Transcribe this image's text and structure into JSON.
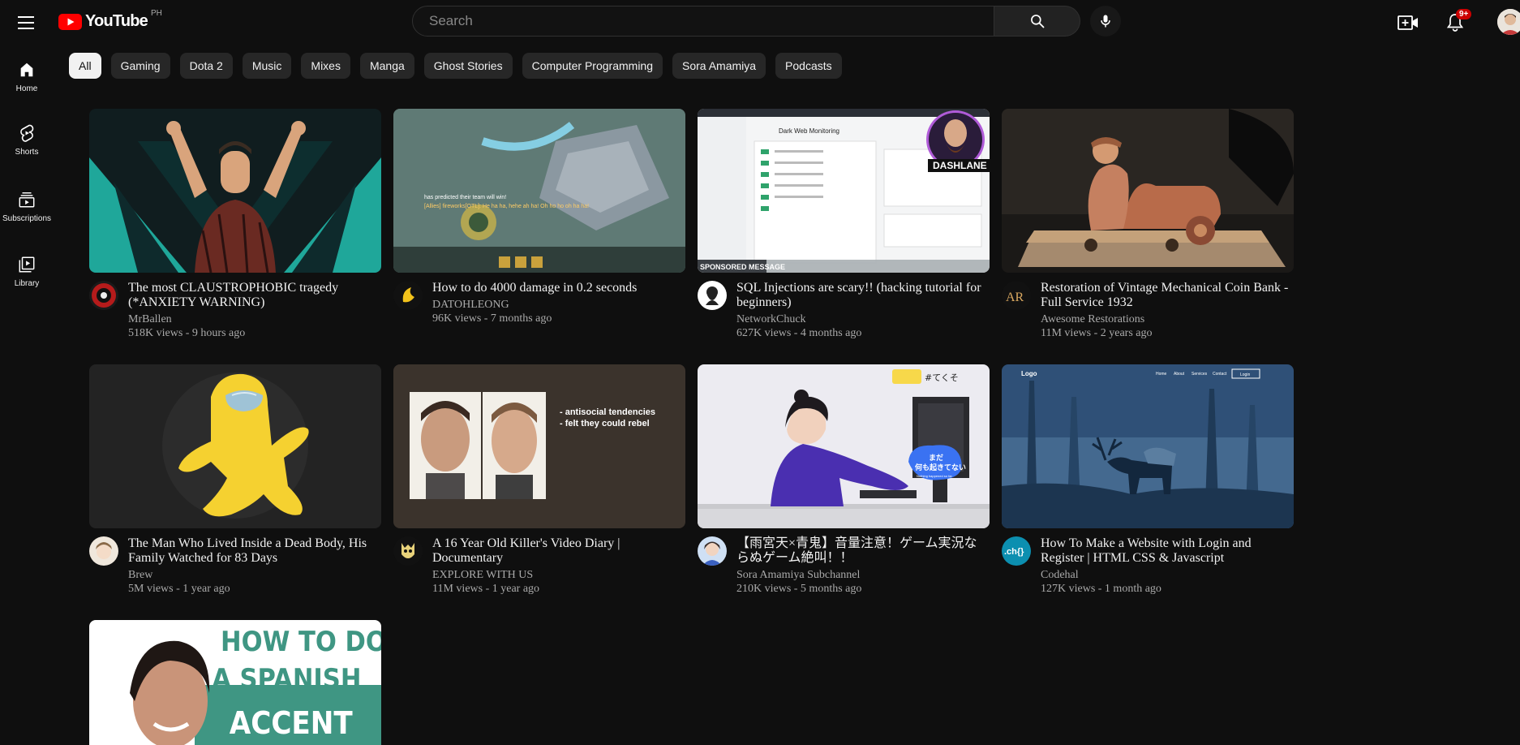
{
  "header": {
    "logo_text": "YouTube",
    "country_code": "PH",
    "search_placeholder": "Search",
    "notification_count": "9+"
  },
  "sidebar": {
    "items": [
      {
        "label": "Home",
        "icon": "home-icon"
      },
      {
        "label": "Shorts",
        "icon": "shorts-icon"
      },
      {
        "label": "Subscriptions",
        "icon": "subscriptions-icon"
      },
      {
        "label": "Library",
        "icon": "library-icon"
      }
    ]
  },
  "chips": [
    "All",
    "Gaming",
    "Dota 2",
    "Music",
    "Mixes",
    "Manga",
    "Ghost Stories",
    "Computer Programming",
    "Sora Amamiya",
    "Podcasts"
  ],
  "videos": [
    {
      "title": "The most CLAUSTROPHOBIC tragedy (*ANXIETY WARNING)",
      "channel": "MrBallen",
      "stats": "518K views - 9 hours ago"
    },
    {
      "title": "How to do 4000 damage in 0.2 seconds",
      "channel": "DATOHLEONG",
      "stats": "96K views - 7 months ago"
    },
    {
      "title": "SQL Injections are scary!! (hacking tutorial for beginners)",
      "channel": "NetworkChuck",
      "stats": "627K views - 4 months ago"
    },
    {
      "title": "Restoration of Vintage Mechanical Coin Bank - Full Service 1932",
      "channel": "Awesome Restorations",
      "stats": "11M views - 2 years ago"
    },
    {
      "title": "The Man Who Lived Inside a Dead Body, His Family Watched for 83 Days",
      "channel": "Brew",
      "stats": "5M views - 1 year ago"
    },
    {
      "title": "A 16 Year Old Killer's Video Diary | Documentary",
      "channel": "EXPLORE WITH US",
      "stats": "11M views - 1 year ago"
    },
    {
      "title": "【雨宮天×青鬼】音量注意！ゲーム実況ならぬゲーム絶叫！！",
      "channel": "Sora Amamiya Subchannel",
      "stats": "210K views - 5 months ago"
    },
    {
      "title": "How To Make a Website with Login and Register | HTML CSS & Javascript",
      "channel": "Codehal",
      "stats": "127K views - 1 month ago"
    },
    {
      "title": "",
      "channel": "",
      "stats": ""
    }
  ],
  "thumb_text": {
    "dota_line1": "has predicted their team will win!",
    "dota_line2": "[Allies] fireworks[OTL]: He ha ha, hehe ah ha! Oh ho ho oh ha ha!",
    "sql_header": "Dark Web Monitoring",
    "sql_sponsor": "SPONSORED MESSAGE",
    "sql_brand": "DASHLANE",
    "killer_line1": "- antisocial tendencies",
    "killer_line2": "- felt they could rebel",
    "sora_tag": "#てくそ",
    "sora_bubble1": "まだ",
    "sora_bubble2": "何も起きてない",
    "sora_bubble3": "Nothing happened so far",
    "web_logo": "Logo",
    "web_nav": [
      "Home",
      "About",
      "Services",
      "Contact"
    ],
    "web_login": "Login",
    "spanish_line1": "HOW TO DO",
    "spanish_line2": "A SPANISH",
    "spanish_line3": "ACCENT",
    "codehal_avatar": ".ch{}",
    "awesome_avatar": "AR"
  },
  "colors": {
    "youtube_red": "#ff0000",
    "background": "#0f0f0f",
    "chip_bg": "#272727",
    "badge_red": "#cc0000"
  }
}
